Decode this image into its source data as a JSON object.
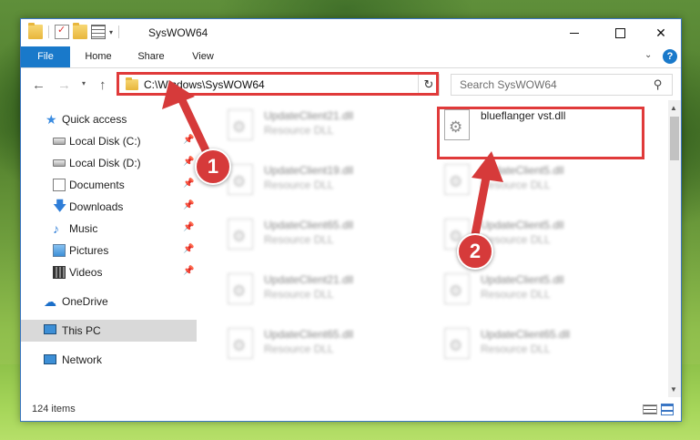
{
  "window": {
    "title": "SysWOW64",
    "qat_dropdown": "▾"
  },
  "ribbon": {
    "tabs": [
      {
        "label": "File"
      },
      {
        "label": "Home"
      },
      {
        "label": "Share"
      },
      {
        "label": "View"
      }
    ],
    "help": "?"
  },
  "nav": {
    "back": "←",
    "forward": "→",
    "recent": "▾",
    "up": "↑"
  },
  "address": {
    "path": "C:\\Windows\\SysWOW64",
    "dropdown": "⌄",
    "refresh": "↻"
  },
  "search": {
    "placeholder": "Search SysWOW64",
    "icon": "search-icon"
  },
  "sidebar": {
    "items": [
      {
        "label": "Quick access",
        "icon": "star-icon"
      },
      {
        "label": "Local Disk (C:)",
        "icon": "disk-icon",
        "pinned": true
      },
      {
        "label": "Local Disk (D:)",
        "icon": "disk-icon",
        "pinned": true
      },
      {
        "label": "Documents",
        "icon": "documents-icon",
        "pinned": true
      },
      {
        "label": "Downloads",
        "icon": "downloads-icon",
        "pinned": true
      },
      {
        "label": "Music",
        "icon": "music-icon",
        "pinned": true
      },
      {
        "label": "Pictures",
        "icon": "pictures-icon",
        "pinned": true
      },
      {
        "label": "Videos",
        "icon": "videos-icon",
        "pinned": true
      },
      {
        "label": "OneDrive",
        "icon": "onedrive-icon"
      },
      {
        "label": "This PC",
        "icon": "pc-icon",
        "selected": true
      },
      {
        "label": "Network",
        "icon": "network-icon"
      }
    ],
    "pin_glyph": "📌"
  },
  "files": [
    {
      "name": "UpdateClient21.dll",
      "type": "Resource DLL",
      "blurred": true
    },
    {
      "name": "blueflanger vst.dll",
      "type": "",
      "blurred": false
    },
    {
      "name": "UpdateClient19.dll",
      "type": "Resource DLL",
      "blurred": true
    },
    {
      "name": "UpdateClient5.dll",
      "type": "Resource DLL",
      "blurred": true
    },
    {
      "name": "UpdateClient65.dll",
      "type": "Resource DLL",
      "blurred": true
    },
    {
      "name": "UpdateClient5.dll",
      "type": "Resource DLL",
      "blurred": true
    },
    {
      "name": "UpdateClient21.dll",
      "type": "Resource DLL",
      "blurred": true
    },
    {
      "name": "UpdateClient5.dll",
      "type": "Resource DLL",
      "blurred": true
    },
    {
      "name": "UpdateClient65.dll",
      "type": "Resource DLL",
      "blurred": true
    },
    {
      "name": "UpdateClient65.dll",
      "type": "Resource DLL",
      "blurred": true
    }
  ],
  "status": {
    "item_count": "124 items"
  },
  "annotations": {
    "badge1": "1",
    "badge2": "2",
    "color": "#d63a3a"
  }
}
